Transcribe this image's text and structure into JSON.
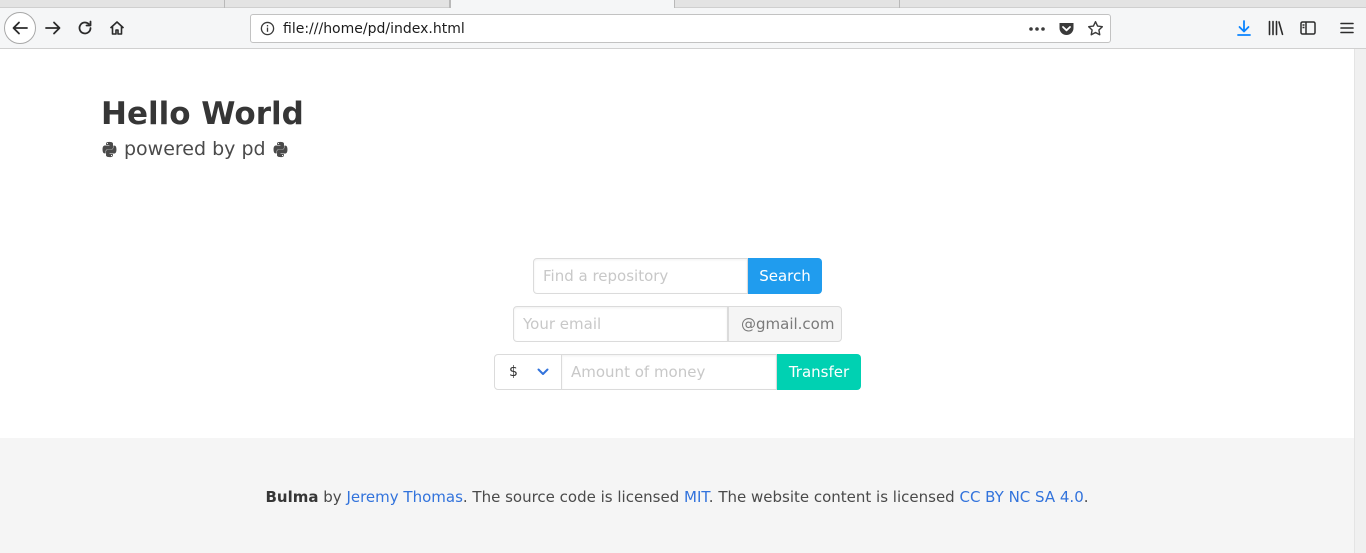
{
  "browser": {
    "url": "file:///home/pd/index.html"
  },
  "hero": {
    "title": "Hello World",
    "subtitle": "powered by pd"
  },
  "search": {
    "placeholder": "Find a repository",
    "button_label": "Search"
  },
  "email": {
    "placeholder": "Your email",
    "domain_addon": "@gmail.com"
  },
  "transfer": {
    "currency_selected": "$",
    "placeholder": "Amount of money",
    "button_label": "Transfer"
  },
  "footer": {
    "brand": "Bulma",
    "by": " by ",
    "author": "Jeremy Thomas",
    "text_1": ". The source code is licensed ",
    "code_license": "MIT",
    "text_2": ". The website content is licensed ",
    "content_license": "CC BY NC SA 4.0",
    "text_3": "."
  },
  "colors": {
    "search_button": "#209cee",
    "transfer_button": "#00d1b2",
    "link": "#3273dc",
    "footer_bg": "#f5f5f5"
  },
  "icons": {
    "subtitle_icon": "python-icon"
  }
}
